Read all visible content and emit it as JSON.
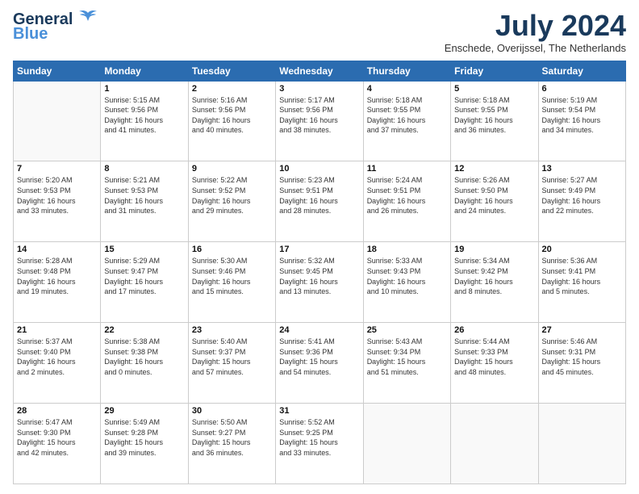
{
  "header": {
    "logo_line1": "General",
    "logo_line2": "Blue",
    "month": "July 2024",
    "location": "Enschede, Overijssel, The Netherlands"
  },
  "weekdays": [
    "Sunday",
    "Monday",
    "Tuesday",
    "Wednesday",
    "Thursday",
    "Friday",
    "Saturday"
  ],
  "weeks": [
    [
      {
        "day": "",
        "text": ""
      },
      {
        "day": "1",
        "text": "Sunrise: 5:15 AM\nSunset: 9:56 PM\nDaylight: 16 hours\nand 41 minutes."
      },
      {
        "day": "2",
        "text": "Sunrise: 5:16 AM\nSunset: 9:56 PM\nDaylight: 16 hours\nand 40 minutes."
      },
      {
        "day": "3",
        "text": "Sunrise: 5:17 AM\nSunset: 9:56 PM\nDaylight: 16 hours\nand 38 minutes."
      },
      {
        "day": "4",
        "text": "Sunrise: 5:18 AM\nSunset: 9:55 PM\nDaylight: 16 hours\nand 37 minutes."
      },
      {
        "day": "5",
        "text": "Sunrise: 5:18 AM\nSunset: 9:55 PM\nDaylight: 16 hours\nand 36 minutes."
      },
      {
        "day": "6",
        "text": "Sunrise: 5:19 AM\nSunset: 9:54 PM\nDaylight: 16 hours\nand 34 minutes."
      }
    ],
    [
      {
        "day": "7",
        "text": "Sunrise: 5:20 AM\nSunset: 9:53 PM\nDaylight: 16 hours\nand 33 minutes."
      },
      {
        "day": "8",
        "text": "Sunrise: 5:21 AM\nSunset: 9:53 PM\nDaylight: 16 hours\nand 31 minutes."
      },
      {
        "day": "9",
        "text": "Sunrise: 5:22 AM\nSunset: 9:52 PM\nDaylight: 16 hours\nand 29 minutes."
      },
      {
        "day": "10",
        "text": "Sunrise: 5:23 AM\nSunset: 9:51 PM\nDaylight: 16 hours\nand 28 minutes."
      },
      {
        "day": "11",
        "text": "Sunrise: 5:24 AM\nSunset: 9:51 PM\nDaylight: 16 hours\nand 26 minutes."
      },
      {
        "day": "12",
        "text": "Sunrise: 5:26 AM\nSunset: 9:50 PM\nDaylight: 16 hours\nand 24 minutes."
      },
      {
        "day": "13",
        "text": "Sunrise: 5:27 AM\nSunset: 9:49 PM\nDaylight: 16 hours\nand 22 minutes."
      }
    ],
    [
      {
        "day": "14",
        "text": "Sunrise: 5:28 AM\nSunset: 9:48 PM\nDaylight: 16 hours\nand 19 minutes."
      },
      {
        "day": "15",
        "text": "Sunrise: 5:29 AM\nSunset: 9:47 PM\nDaylight: 16 hours\nand 17 minutes."
      },
      {
        "day": "16",
        "text": "Sunrise: 5:30 AM\nSunset: 9:46 PM\nDaylight: 16 hours\nand 15 minutes."
      },
      {
        "day": "17",
        "text": "Sunrise: 5:32 AM\nSunset: 9:45 PM\nDaylight: 16 hours\nand 13 minutes."
      },
      {
        "day": "18",
        "text": "Sunrise: 5:33 AM\nSunset: 9:43 PM\nDaylight: 16 hours\nand 10 minutes."
      },
      {
        "day": "19",
        "text": "Sunrise: 5:34 AM\nSunset: 9:42 PM\nDaylight: 16 hours\nand 8 minutes."
      },
      {
        "day": "20",
        "text": "Sunrise: 5:36 AM\nSunset: 9:41 PM\nDaylight: 16 hours\nand 5 minutes."
      }
    ],
    [
      {
        "day": "21",
        "text": "Sunrise: 5:37 AM\nSunset: 9:40 PM\nDaylight: 16 hours\nand 2 minutes."
      },
      {
        "day": "22",
        "text": "Sunrise: 5:38 AM\nSunset: 9:38 PM\nDaylight: 16 hours\nand 0 minutes."
      },
      {
        "day": "23",
        "text": "Sunrise: 5:40 AM\nSunset: 9:37 PM\nDaylight: 15 hours\nand 57 minutes."
      },
      {
        "day": "24",
        "text": "Sunrise: 5:41 AM\nSunset: 9:36 PM\nDaylight: 15 hours\nand 54 minutes."
      },
      {
        "day": "25",
        "text": "Sunrise: 5:43 AM\nSunset: 9:34 PM\nDaylight: 15 hours\nand 51 minutes."
      },
      {
        "day": "26",
        "text": "Sunrise: 5:44 AM\nSunset: 9:33 PM\nDaylight: 15 hours\nand 48 minutes."
      },
      {
        "day": "27",
        "text": "Sunrise: 5:46 AM\nSunset: 9:31 PM\nDaylight: 15 hours\nand 45 minutes."
      }
    ],
    [
      {
        "day": "28",
        "text": "Sunrise: 5:47 AM\nSunset: 9:30 PM\nDaylight: 15 hours\nand 42 minutes."
      },
      {
        "day": "29",
        "text": "Sunrise: 5:49 AM\nSunset: 9:28 PM\nDaylight: 15 hours\nand 39 minutes."
      },
      {
        "day": "30",
        "text": "Sunrise: 5:50 AM\nSunset: 9:27 PM\nDaylight: 15 hours\nand 36 minutes."
      },
      {
        "day": "31",
        "text": "Sunrise: 5:52 AM\nSunset: 9:25 PM\nDaylight: 15 hours\nand 33 minutes."
      },
      {
        "day": "",
        "text": ""
      },
      {
        "day": "",
        "text": ""
      },
      {
        "day": "",
        "text": ""
      }
    ]
  ]
}
